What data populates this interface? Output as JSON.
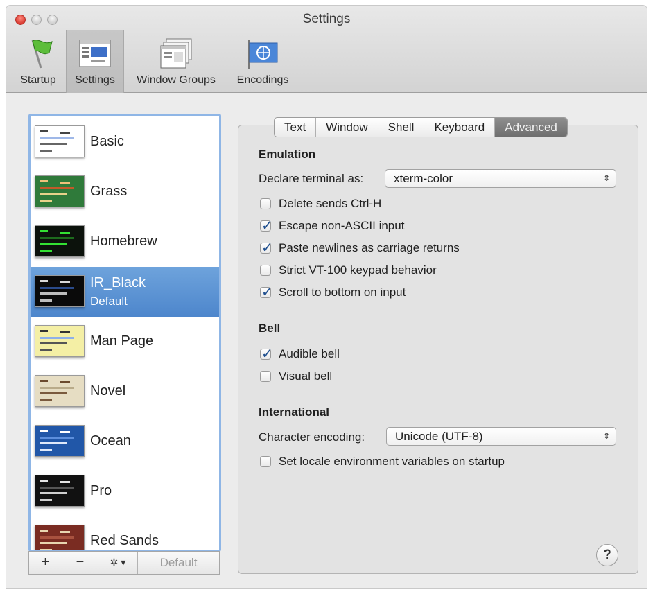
{
  "window": {
    "title": "Settings"
  },
  "toolbar": {
    "items": [
      {
        "label": "Startup",
        "icon": "startup-flag-icon"
      },
      {
        "label": "Settings",
        "icon": "settings-window-icon",
        "selected": true
      },
      {
        "label": "Window Groups",
        "icon": "window-groups-icon"
      },
      {
        "label": "Encodings",
        "icon": "encodings-globe-icon"
      }
    ]
  },
  "profiles": {
    "items": [
      {
        "name": "Basic",
        "bg": "#ffffff",
        "fg": "#444444"
      },
      {
        "name": "Grass",
        "bg": "#2f7a3a",
        "fg": "#f0c07a"
      },
      {
        "name": "Homebrew",
        "bg": "#0c120c",
        "fg": "#33e033"
      },
      {
        "name": "IR_Black",
        "subtitle": "Default",
        "bg": "#0a0a0a",
        "fg": "#d8d8d8",
        "selected": true
      },
      {
        "name": "Man Page",
        "bg": "#f4efa5",
        "fg": "#333333"
      },
      {
        "name": "Novel",
        "bg": "#e6ddc3",
        "fg": "#6b4a2e"
      },
      {
        "name": "Ocean",
        "bg": "#2157a8",
        "fg": "#ffffff"
      },
      {
        "name": "Pro",
        "bg": "#111111",
        "fg": "#e4e4e4"
      },
      {
        "name": "Red Sands",
        "bg": "#7a2c22",
        "fg": "#e8d6b0"
      }
    ],
    "add_label": "+",
    "remove_label": "−",
    "action_label": "✲ ▾",
    "default_label": "Default"
  },
  "tabs": {
    "items": [
      "Text",
      "Window",
      "Shell",
      "Keyboard",
      "Advanced"
    ],
    "active": "Advanced"
  },
  "emulation": {
    "title": "Emulation",
    "declare_label": "Declare terminal as:",
    "declare_value": "xterm-color",
    "options": [
      {
        "label": "Delete sends Ctrl-H",
        "checked": false
      },
      {
        "label": "Escape non-ASCII input",
        "checked": true
      },
      {
        "label": "Paste newlines as carriage returns",
        "checked": true
      },
      {
        "label": "Strict VT-100 keypad behavior",
        "checked": false
      },
      {
        "label": "Scroll to bottom on input",
        "checked": true
      }
    ]
  },
  "bell": {
    "title": "Bell",
    "options": [
      {
        "label": "Audible bell",
        "checked": true
      },
      {
        "label": "Visual bell",
        "checked": false
      }
    ]
  },
  "international": {
    "title": "International",
    "encoding_label": "Character encoding:",
    "encoding_value": "Unicode (UTF-8)",
    "options": [
      {
        "label": "Set locale environment variables on startup",
        "checked": false
      }
    ]
  },
  "help": {
    "label": "?"
  },
  "colors": {
    "accent": "#4d86cc",
    "focus_ring": "#8fb6e6"
  }
}
